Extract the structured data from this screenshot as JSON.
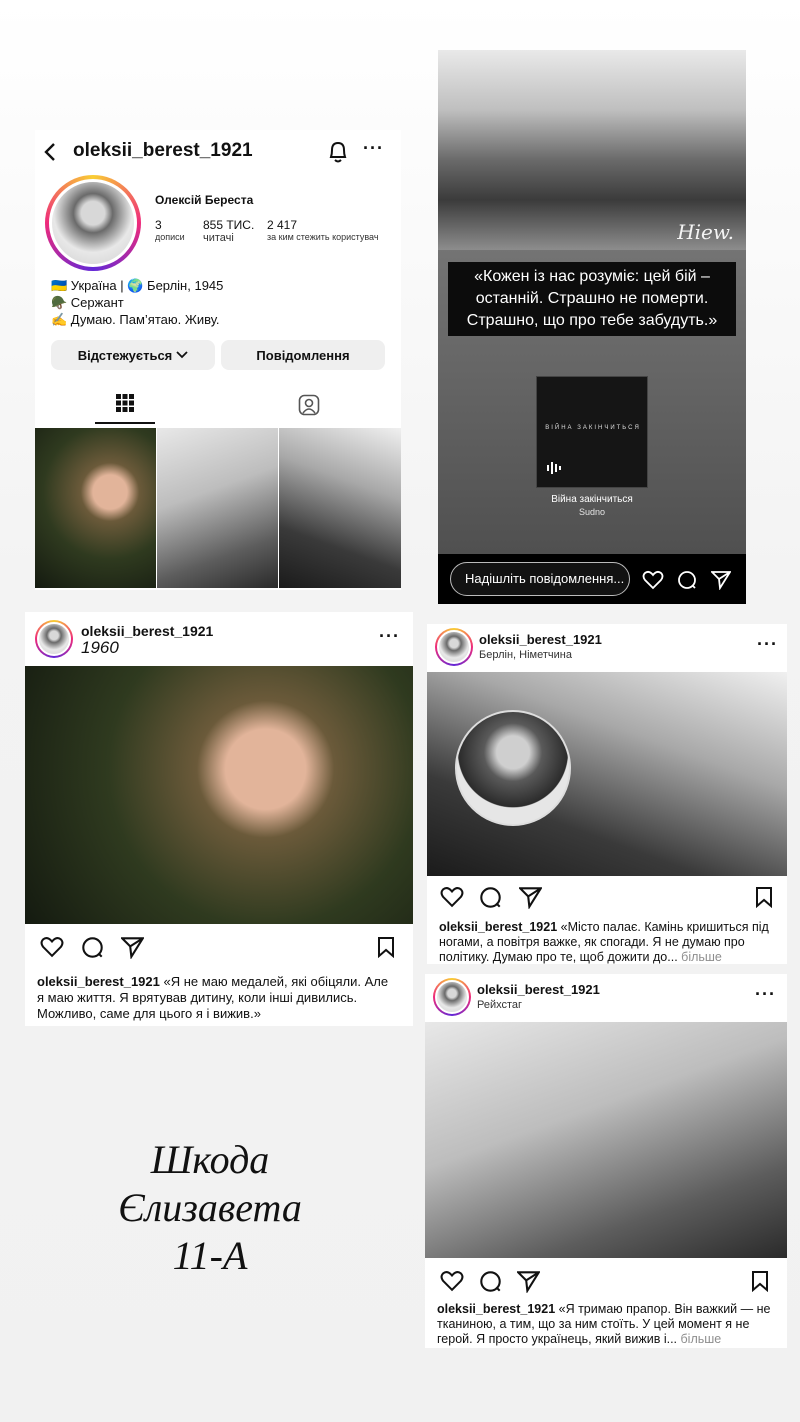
{
  "profile": {
    "username": "oleksii_berest_1921",
    "full_name": "Олексій Береста",
    "stats": [
      {
        "value": "3",
        "label": "дописи"
      },
      {
        "value": "855 тис.",
        "label": "читачі"
      },
      {
        "value": "2 417",
        "label": "за ким стежить користувач"
      }
    ],
    "bio": [
      "🇺🇦 Україна | 🌍 Берлін, 1945",
      "🪖 Сержант",
      "✍️ Думаю. Пам’ятаю. Живу."
    ],
    "follow_button": "Відстежується",
    "message_button": "Повідомлення"
  },
  "story": {
    "watermark": "Hiew.",
    "quote": "«Кожен із нас розуміє: цей бій – останній. Страшно не померти. Страшно, що про тебе забудуть.»",
    "music_cover_text": "Війна закінчиться",
    "music_title": "Війна закінчиться",
    "music_artist": "Sudno",
    "reply_placeholder": "Надішліть повідомлення..."
  },
  "post1": {
    "username": "oleksii_berest_1921",
    "subtitle": "1960",
    "caption_user": "oleksii_berest_1921",
    "caption_text": "«Я не маю медалей, які обіцяли. Але я маю життя. Я врятував дитину, коли інші дивились. Можливо, саме для цього я і вижив.»"
  },
  "post2": {
    "username": "oleksii_berest_1921",
    "location": "Берлін, Німетчина",
    "caption_user": "oleksii_berest_1921",
    "caption_text": "«Місто палає. Камінь кришиться під ногами, а повітря важке, як спогади. Я не думаю про політику. Думаю про те, щоб дожити до...",
    "more_label": "більше"
  },
  "post3": {
    "username": "oleksii_berest_1921",
    "location": "Рейхстаг",
    "caption_user": "oleksii_berest_1921",
    "caption_text": "«Я тримаю прапор. Він важкий — не тканиною, а тим, що за ним стоїть. У цей момент я не герой. Я просто українець, який вижив і...",
    "more_label": "більше"
  },
  "author": [
    "Шкода",
    "Єлизавета",
    "11-А"
  ]
}
